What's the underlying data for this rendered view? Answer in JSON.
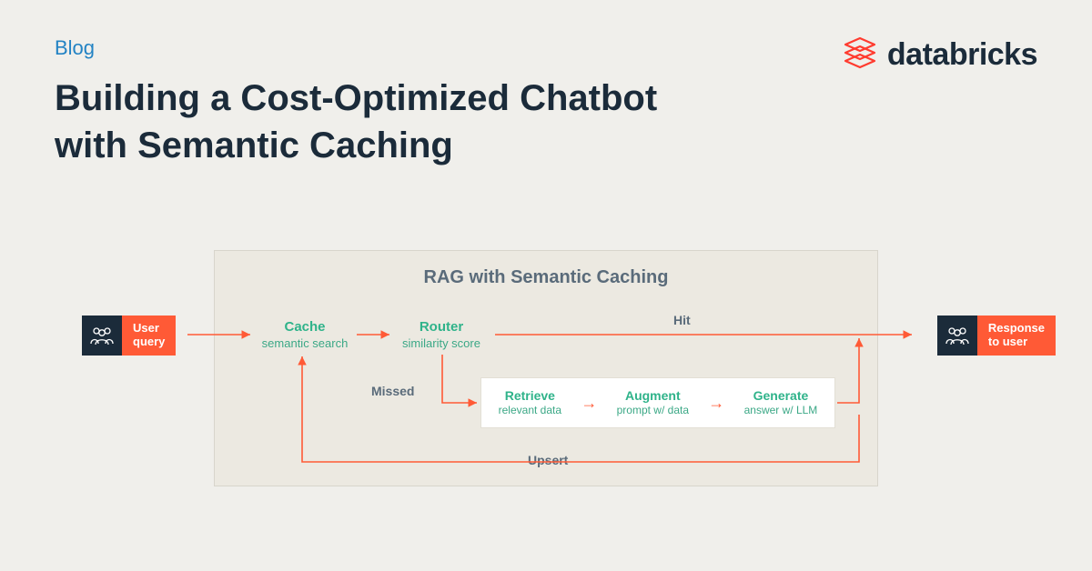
{
  "header": {
    "category": "Blog",
    "title": "Building a Cost-Optimized Chatbot with Semantic Caching"
  },
  "brand": {
    "name": "databricks"
  },
  "diagram": {
    "title": "RAG with Semantic Caching",
    "input": {
      "line1": "User",
      "line2": "query"
    },
    "output": {
      "line1": "Response",
      "line2": "to user"
    },
    "nodes": {
      "cache": {
        "title": "Cache",
        "sub": "semantic search"
      },
      "router": {
        "title": "Router",
        "sub": "similarity score"
      },
      "retrieve": {
        "title": "Retrieve",
        "sub": "relevant data"
      },
      "augment": {
        "title": "Augment",
        "sub": "prompt w/ data"
      },
      "generate": {
        "title": "Generate",
        "sub": "answer w/ LLM"
      }
    },
    "edges": {
      "hit": "Hit",
      "missed": "Missed",
      "upsert": "Upsert"
    }
  }
}
